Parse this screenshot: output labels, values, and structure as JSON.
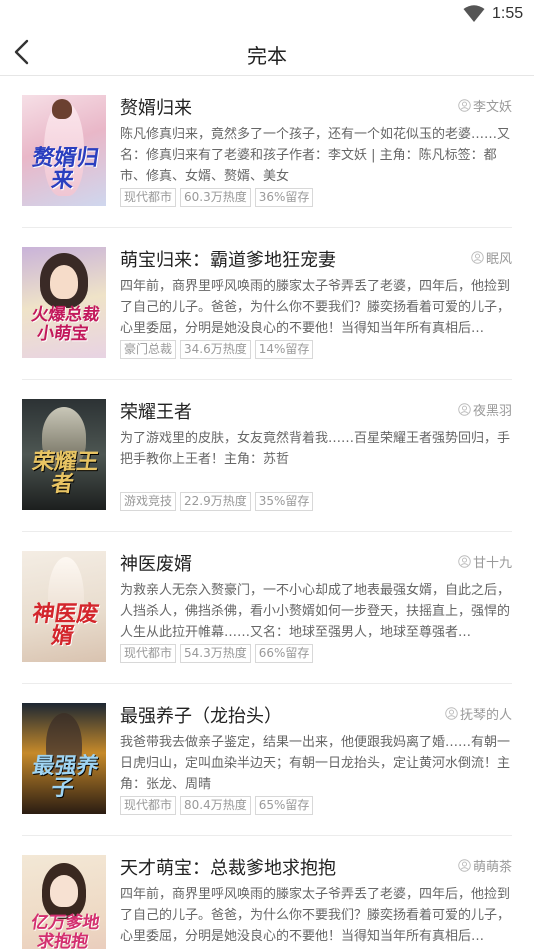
{
  "status": {
    "time": "1:55"
  },
  "nav": {
    "title": "完本"
  },
  "books": [
    {
      "title": "赘婿归来",
      "author": "李文妖",
      "desc": "陈凡修真归来，竟然多了一个孩子，还有一个如花似玉的老婆……又名：修真归来有了老婆和孩子作者：李文妖 | 主角：陈凡标签：都市、修真、女婿、赘婿、美女",
      "tags": [
        "现代都市",
        "60.3万热度",
        "36%留存"
      ],
      "cover_text": "赘婿归来"
    },
    {
      "title": "萌宝归来：霸道爹地狂宠妻",
      "author": "眠风",
      "desc": "四年前，商界里呼风唤雨的滕家太子爷弄丢了老婆，四年后，他捡到了自己的儿子。爸爸，为什么你不要我们？滕奕扬看着可爱的儿子，心里委屈，分明是她没良心的不要他！当得知当年所有真相后…",
      "tags": [
        "豪门总裁",
        "34.6万热度",
        "14%留存"
      ],
      "cover_text": "火爆总裁小萌宝"
    },
    {
      "title": "荣耀王者",
      "author": "夜黑羽",
      "desc": "为了游戏里的皮肤，女友竟然背着我……百星荣耀王者强势回归，手把手教你上王者！主角：苏哲",
      "tags": [
        "游戏竞技",
        "22.9万热度",
        "35%留存"
      ],
      "cover_text": "荣耀王者"
    },
    {
      "title": "神医废婿",
      "author": "甘十九",
      "desc": "为救亲人无奈入赘豪门，一不小心却成了地表最强女婿，自此之后，人挡杀人，佛挡杀佛，看小小赘婿如何一步登天，扶摇直上，强悍的人生从此拉开帷幕……又名：地球至强男人，地球至尊强者…",
      "tags": [
        "现代都市",
        "54.3万热度",
        "66%留存"
      ],
      "cover_text": "神医废婿"
    },
    {
      "title": "最强养子（龙抬头）",
      "author": "抚琴的人",
      "desc": "我爸带我去做亲子鉴定，结果一出来，他便跟我妈离了婚……有朝一日虎归山，定叫血染半边天；有朝一日龙抬头，定让黄河水倒流！主角：张龙、周晴",
      "tags": [
        "现代都市",
        "80.4万热度",
        "65%留存"
      ],
      "cover_text": "最强养子"
    },
    {
      "title": "天才萌宝：总裁爹地求抱抱",
      "author": "萌萌茶",
      "desc": "四年前，商界里呼风唤雨的滕家太子爷弄丢了老婆，四年后，他捡到了自己的儿子。爸爸，为什么你不要我们？滕奕扬看着可爱的儿子，心里委屈，分明是她没良心的不要他！当得知当年所有真相后…",
      "tags": [
        "",
        "",
        ""
      ],
      "cover_text": "亿万爹地求抱抱"
    }
  ]
}
